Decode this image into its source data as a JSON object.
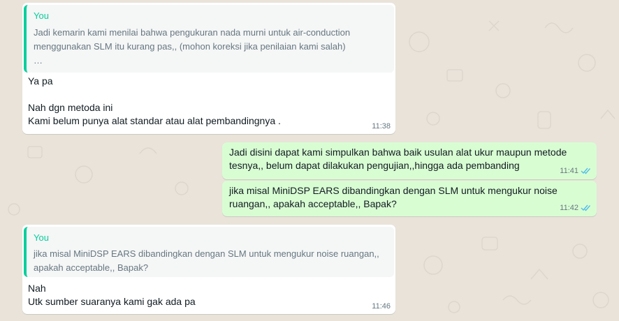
{
  "messages": [
    {
      "quote": {
        "author": "You",
        "lines": [
          "Jadi kemarin kami menilai bahwa pengukuran nada murni untuk air-conduction",
          "menggunakan SLM itu kurang pas,, (mohon koreksi jika penilaian kami salah)",
          "…"
        ]
      },
      "lines": [
        "Ya pa",
        "Nah dgn metoda ini",
        "Kami belum punya alat standar atau alat pembandingnya ."
      ],
      "time": "11:38"
    },
    {
      "lines": [
        "Jadi disini dapat kami simpulkan bahwa baik usulan alat ukur maupun metode",
        "tesnya,, belum dapat dilakukan pengujian,,hingga ada pembanding"
      ],
      "time": "11:41"
    },
    {
      "lines": [
        "jika misal MiniDSP EARS dibandingkan dengan SLM untuk mengukur noise",
        "ruangan,, apakah acceptable,, Bapak?"
      ],
      "time": "11:42"
    },
    {
      "quote": {
        "author": "You",
        "lines": [
          "jika misal MiniDSP EARS dibandingkan dengan SLM untuk mengukur noise ruangan,,",
          "apakah acceptable,, Bapak?"
        ]
      },
      "lines": [
        "Nah",
        "Utk sumber suaranya kami gak ada pa"
      ],
      "time": "11:46"
    }
  ],
  "colors": {
    "incoming_bubble": "#ffffff",
    "outgoing_bubble": "#d9fdd3",
    "quote_accent": "#06cf9c",
    "read_ticks": "#53bdeb",
    "chat_background": "#e9e3da"
  },
  "icons": {
    "read_receipt": "double-check-icon"
  }
}
